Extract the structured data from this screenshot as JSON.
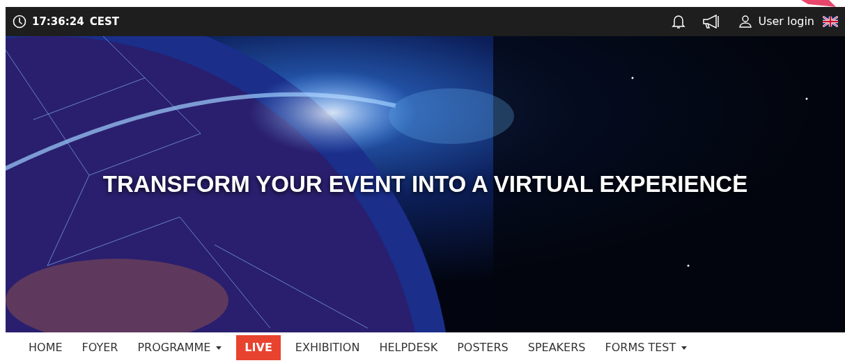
{
  "top_bar": {
    "time": "17:36:24",
    "timezone": "CEST",
    "login_label": "User login"
  },
  "hero": {
    "headline": "TRANSFORM YOUR EVENT INTO A VIRTUAL EXPERIENCE"
  },
  "nav": [
    {
      "label": "HOME",
      "selected": false,
      "dropdown": false
    },
    {
      "label": "FOYER",
      "selected": false,
      "dropdown": false
    },
    {
      "label": "PROGRAMME",
      "selected": false,
      "dropdown": true
    },
    {
      "label": "LIVE",
      "selected": true,
      "dropdown": false
    },
    {
      "label": "EXHIBITION",
      "selected": false,
      "dropdown": false
    },
    {
      "label": "HELPDESK",
      "selected": false,
      "dropdown": false
    },
    {
      "label": "POSTERS",
      "selected": false,
      "dropdown": false
    },
    {
      "label": "SPEAKERS",
      "selected": false,
      "dropdown": false
    },
    {
      "label": "FORMS TEST",
      "selected": false,
      "dropdown": true
    }
  ]
}
